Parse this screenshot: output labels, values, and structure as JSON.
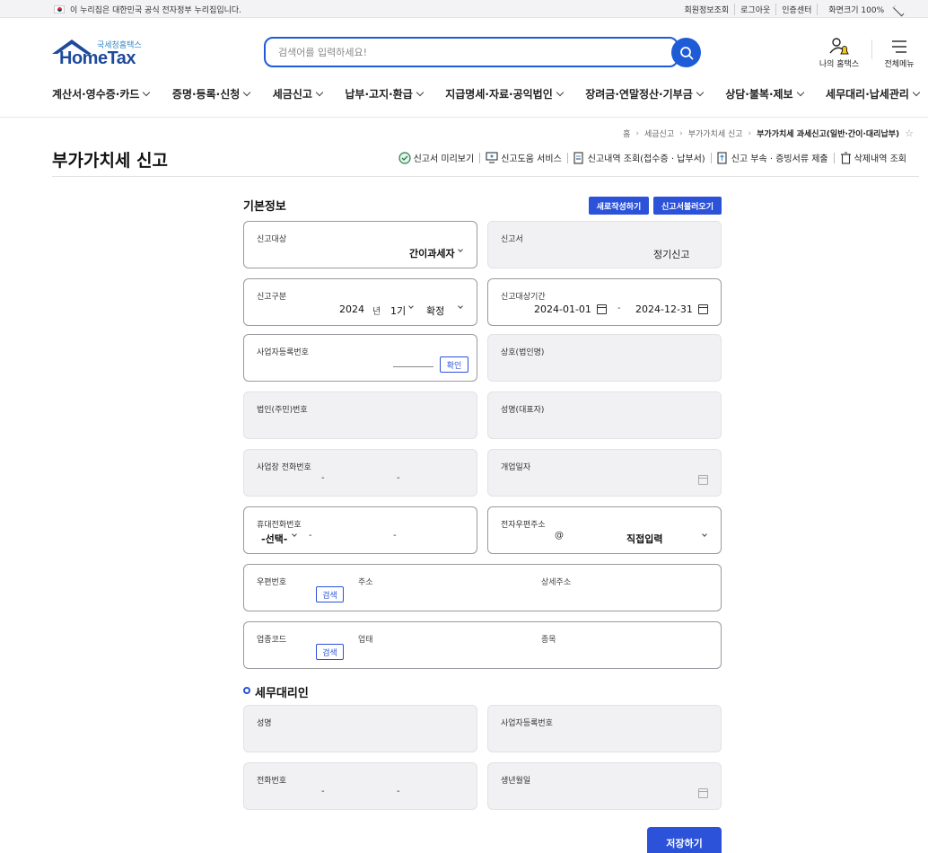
{
  "topbar": {
    "notice": "이 누리집은 대한민국 공식 전자정부 누리집입니다.",
    "links": [
      "회원정보조회",
      "로그아웃",
      "인증센터",
      "화면크기 100%"
    ]
  },
  "header": {
    "logo_sub": "국세청홈택스",
    "logo_brand": "HomeTax",
    "search_placeholder": "검색어를 입력하세요!",
    "my_hometax": "나의 홈택스",
    "all_menu": "전체메뉴"
  },
  "gnb": [
    "계산서·영수증·카드",
    "증명·등록·신청",
    "세금신고",
    "납부·고지·환급",
    "지급명세·자료·공익법인",
    "장려금·연말정산·기부금",
    "상담·불복·제보",
    "세무대리·납세관리"
  ],
  "breadcrumb": [
    "홈",
    "세금신고",
    "부가가치세 신고",
    "부가가치세 과세신고(일반·간이·대리납부)"
  ],
  "page": {
    "title": "부가가치세 신고",
    "tools": [
      "신고서 미리보기",
      "신고도움 서비스",
      "신고내역 조회(접수증 · 납부서)",
      "신고 부속 · 증빙서류 제출",
      "삭제내역 조회"
    ]
  },
  "basic": {
    "title": "기본정보",
    "new_btn": "새로작성하기",
    "load_btn": "신고서불러오기",
    "target_label": "신고대상",
    "target_value": "간이과세자",
    "form_label": "신고서",
    "form_value": "정기신고",
    "kind_label": "신고구분",
    "year": "2024",
    "year_unit": "년",
    "term": "1기",
    "status": "확정",
    "period_label": "신고대상기간",
    "period_from": "2024-01-01",
    "period_sep": "-",
    "period_to": "2024-12-31",
    "bizno_label": "사업자등록번호",
    "confirm_btn": "확인",
    "company_label": "상호(법인명)",
    "corpno_label": "법인(주민)번호",
    "name_label": "성명(대표자)",
    "phone_label": "사업장 전화번호",
    "dash": "-",
    "open_label": "개업일자",
    "mobile_label": "휴대전화번호",
    "mobile_select": "-선택-",
    "email_label": "전자우편주소",
    "email_at": "@",
    "email_select": "직접입력",
    "zip_label": "우편번호",
    "search_btn": "검색",
    "addr_label": "주소",
    "addr_detail_label": "상세주소",
    "industry_label": "업종코드",
    "biz_type_label": "업태",
    "biz_item_label": "종목"
  },
  "agent": {
    "title": "세무대리인",
    "name_label": "성명",
    "bizno_label": "사업자등록번호",
    "phone_label": "전화번호",
    "birth_label": "생년월일"
  },
  "save_btn": "저장하기"
}
